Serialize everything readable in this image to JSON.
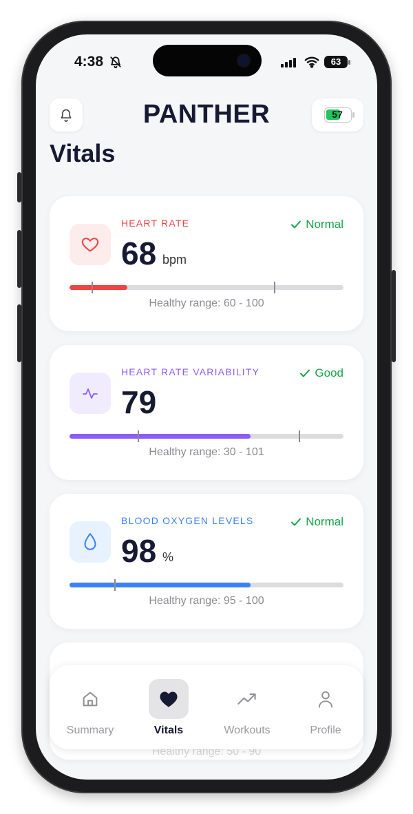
{
  "status_bar": {
    "time": "4:38",
    "battery": "63"
  },
  "header": {
    "brand": "PANTHER",
    "device_battery": "57"
  },
  "page": {
    "title": "Vitals"
  },
  "vitals": [
    {
      "label": "HEART RATE",
      "status": "Normal",
      "value": "68",
      "unit": "bpm",
      "range": "Healthy range: 60 - 100",
      "accent": "#ef4444",
      "icon_bg": "#fdecec",
      "icon": "heart-outline-icon",
      "progress": 0.21
    },
    {
      "label": "HEART RATE VARIABILITY",
      "status": "Good",
      "value": "79",
      "unit": "",
      "range": "Healthy range: 30 - 101",
      "accent": "#8b5cf6",
      "icon_bg": "#f1ecfd",
      "icon": "pulse-icon",
      "progress": 0.66
    },
    {
      "label": "BLOOD OXYGEN LEVELS",
      "status": "Normal",
      "value": "98",
      "unit": "%",
      "range": "Healthy range: 95 - 100",
      "accent": "#3b82f6",
      "icon_bg": "#e8f1fe",
      "icon": "droplet-icon",
      "progress": 0.66
    }
  ],
  "hidden_card": {
    "range": "Healthy range: 50 - 90"
  },
  "nav": {
    "items": [
      {
        "label": "Summary",
        "icon": "home-icon"
      },
      {
        "label": "Vitals",
        "icon": "heart-icon"
      },
      {
        "label": "Workouts",
        "icon": "trend-up-icon"
      },
      {
        "label": "Profile",
        "icon": "user-icon"
      }
    ]
  },
  "colors": {
    "ok": "#16a34a",
    "brand": "#161a33",
    "bg": "#f5f6f8"
  }
}
